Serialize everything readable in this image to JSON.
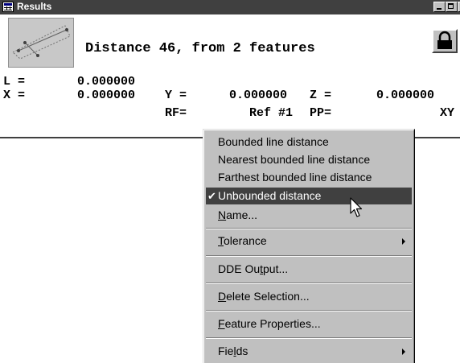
{
  "window": {
    "title": "Results",
    "controls": {
      "minimize": "_",
      "maximize": "□",
      "close": "×"
    }
  },
  "results": {
    "headline": "Distance 46, from 2 features",
    "row1": {
      "label": "L =",
      "value": "0.000000"
    },
    "row2": {
      "x_label": "X =",
      "x_value": "0.000000",
      "y_label": "Y =",
      "y_value": "0.000000",
      "z_label": "Z =",
      "z_value": "0.000000"
    },
    "row3": {
      "rf_label": "RF=",
      "rf_value": "Ref #1",
      "pp_label": "PP=",
      "pp_value": "XY"
    }
  },
  "context_menu": {
    "group1": [
      {
        "label": "Bounded line distance",
        "checked": false
      },
      {
        "label": "Nearest bounded line distance",
        "checked": false
      },
      {
        "label": "Farthest bounded line distance",
        "checked": false
      },
      {
        "label": "Unbounded distance",
        "checked": true,
        "highlighted": true
      },
      {
        "label_pre": "",
        "label_u": "N",
        "label_post": "ame..."
      }
    ],
    "tolerance": {
      "label_pre": "",
      "label_u": "T",
      "label_post": "olerance",
      "submenu": true
    },
    "dde_output": {
      "label_pre": "DDE Ou",
      "label_u": "t",
      "label_post": "put..."
    },
    "delete_selection": {
      "label_pre": "",
      "label_u": "D",
      "label_post": "elete Selection..."
    },
    "feature_properties": {
      "label_pre": "",
      "label_u": "F",
      "label_post": "eature Properties..."
    },
    "fields": {
      "label_pre": "Fie",
      "label_u": "l",
      "label_post": "ds",
      "submenu": true
    }
  },
  "colors": {
    "titlebar": "#404040",
    "menu_bg": "#c0c0c0",
    "highlight": "#404040"
  },
  "icons": [
    "results-window-icon",
    "lock-icon",
    "feature-thumbnail",
    "check-icon",
    "submenu-arrow-icon",
    "mouse-pointer-icon"
  ]
}
